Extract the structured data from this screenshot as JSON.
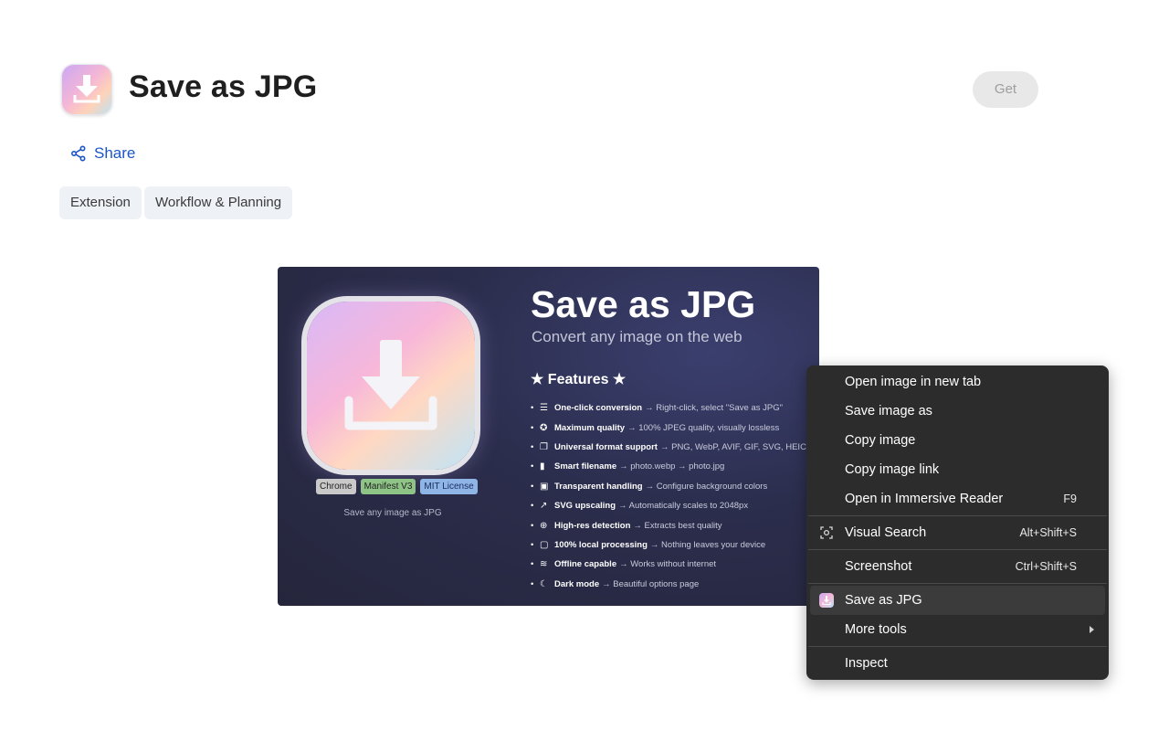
{
  "app": {
    "title": "Save as JPG",
    "get_label": "Get",
    "share_label": "Share"
  },
  "chips": [
    "Extension",
    "Workflow & Planning"
  ],
  "screenshot": {
    "title": "Save as JPG",
    "subtitle": "Convert any image on the web",
    "features_heading": "★ Features ★",
    "tags": [
      "Chrome",
      "Manifest V3",
      "MIT License"
    ],
    "caption": "Save any image as JPG",
    "features": [
      {
        "icon": "pointer-icon",
        "glyph": "☰",
        "bold": "One-click conversion",
        "text": "→ Right-click, select \"Save as JPG\""
      },
      {
        "icon": "medal-icon",
        "glyph": "✪",
        "bold": "Maximum quality",
        "text": "→ 100% JPEG quality, visually lossless"
      },
      {
        "icon": "documents-icon",
        "glyph": "❐",
        "bold": "Universal format support",
        "text": "→ PNG, WebP, AVIF, GIF, SVG, HEIC"
      },
      {
        "icon": "file-icon",
        "glyph": "▮",
        "bold": "Smart filename",
        "text": "→ photo.webp → photo.jpg"
      },
      {
        "icon": "palette-icon",
        "glyph": "▣",
        "bold": "Transparent handling",
        "text": "→ Configure background colors"
      },
      {
        "icon": "upscale-arrow-icon",
        "glyph": "↗",
        "bold": "SVG upscaling",
        "text": "→ Automatically scales to 2048px"
      },
      {
        "icon": "magnifier-icon",
        "glyph": "⊕",
        "bold": "High-res detection",
        "text": "→ Extracts best quality"
      },
      {
        "icon": "chip-icon",
        "glyph": "▢",
        "bold": "100% local processing",
        "text": "→ Nothing leaves your device"
      },
      {
        "icon": "wifi-off-icon",
        "glyph": "≋",
        "bold": "Offline capable",
        "text": "→ Works without internet"
      },
      {
        "icon": "moon-icon",
        "glyph": "☾",
        "bold": "Dark mode",
        "text": "→ Beautiful options page"
      }
    ]
  },
  "context_menu": {
    "items": [
      {
        "label": "Open image in new tab",
        "shortcut": ""
      },
      {
        "label": "Save image as",
        "shortcut": ""
      },
      {
        "label": "Copy image",
        "shortcut": ""
      },
      {
        "label": "Copy image link",
        "shortcut": ""
      },
      {
        "label": "Open in Immersive Reader",
        "shortcut": "F9"
      },
      {
        "label": "Visual Search",
        "shortcut": "Alt+Shift+S"
      },
      {
        "label": "Screenshot",
        "shortcut": "Ctrl+Shift+S"
      },
      {
        "label": "Save as JPG",
        "shortcut": ""
      },
      {
        "label": "More tools",
        "shortcut": ""
      },
      {
        "label": "Inspect",
        "shortcut": ""
      }
    ]
  },
  "colors": {
    "accent": "#1a56c8",
    "menu_bg": "#2c2c2c",
    "shot_bg": "#2b2d4c"
  }
}
